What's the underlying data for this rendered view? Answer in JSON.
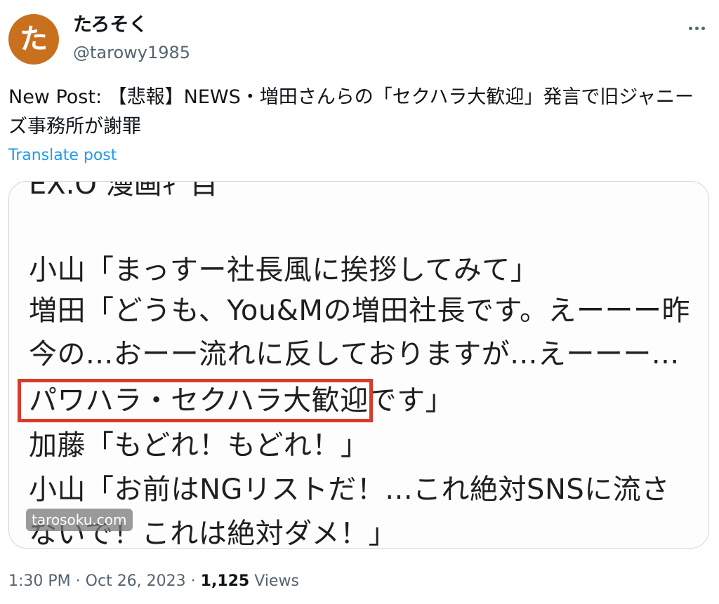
{
  "user": {
    "avatar_glyph": "た",
    "avatar_color": "#c9701f",
    "display_name": "たろそく",
    "handle": "@tarowy1985"
  },
  "post": {
    "text": "New Post: 【悲報】NEWS・増田さんらの「セクハラ大歓迎」発言で旧ジャニーズ事務所が謝罪",
    "translate_label": "Translate post",
    "image": {
      "clipped_top_line": "EX.O 漫画ｷﾞ目",
      "lines": [
        "小山「まっすー社長風に挨拶してみて」",
        "増田「どうも、You&Mの増田社長です。えーーー昨",
        "今の...おーー流れに反しておりますが...えーーー...",
        "パワハラ・セクハラ大歓迎です」",
        "加藤「もどれ！もどれ！」",
        "小山「お前はNGリストだ！...これ絶対SNSに流さ",
        "ないで！これは絶対ダメ！」"
      ],
      "highlight_color": "#d93a2b",
      "watermark": "tarosoku.com"
    },
    "time": "1:30 PM",
    "date": "Oct 26, 2023",
    "views_count": "1,125",
    "views_label": "Views"
  },
  "icons": {
    "more": "more-horizontal-icon"
  },
  "colors": {
    "link": "#1d9bf0",
    "muted": "#536471",
    "border": "#cfd9de"
  }
}
